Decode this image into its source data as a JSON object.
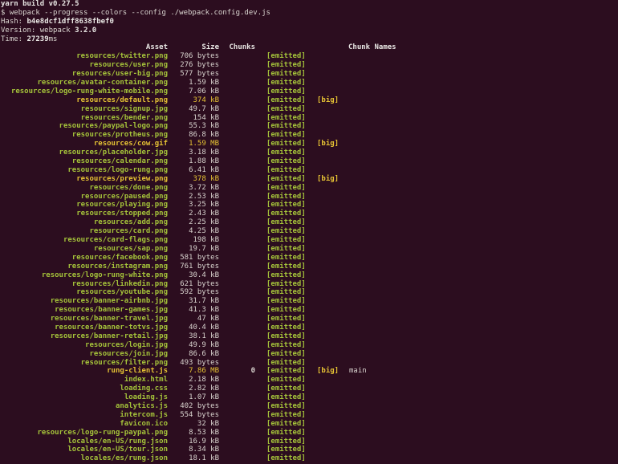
{
  "header_lines": [
    "yarn build v0.27.5",
    "$ webpack --progress --colors --config ./webpack.config.dev.js"
  ],
  "hash": {
    "label": "Hash: ",
    "value": "b4e8dcf1dff8638fbef0"
  },
  "version": {
    "label": "Version: webpack ",
    "value": "3.2.0"
  },
  "time": {
    "label": "Time: ",
    "value": "27239",
    "unit": "ms"
  },
  "table": {
    "columns": {
      "asset": "Asset",
      "size": "Size",
      "chunks": "Chunks",
      "names": "Chunk Names"
    },
    "rows": [
      {
        "asset": "resources/twitter.png",
        "size": "706 bytes",
        "status": "[emitted]"
      },
      {
        "asset": "resources/user.png",
        "size": "276 bytes",
        "status": "[emitted]"
      },
      {
        "asset": "resources/user-big.png",
        "size": "577 bytes",
        "status": "[emitted]"
      },
      {
        "asset": "resources/avatar-container.png",
        "size": "1.59 kB",
        "status": "[emitted]"
      },
      {
        "asset": "resources/logo-rung-white-mobile.png",
        "size": "7.06 kB",
        "status": "[emitted]"
      },
      {
        "asset": "resources/default.png",
        "size": "374 kB",
        "status": "[emitted]",
        "flag": "[big]",
        "big": true
      },
      {
        "asset": "resources/signup.jpg",
        "size": "49.7 kB",
        "status": "[emitted]"
      },
      {
        "asset": "resources/bender.png",
        "size": "154 kB",
        "status": "[emitted]"
      },
      {
        "asset": "resources/paypal-logo.png",
        "size": "55.3 kB",
        "status": "[emitted]"
      },
      {
        "asset": "resources/protheus.png",
        "size": "86.8 kB",
        "status": "[emitted]"
      },
      {
        "asset": "resources/cow.gif",
        "size": "1.59 MB",
        "status": "[emitted]",
        "flag": "[big]",
        "big": true
      },
      {
        "asset": "resources/placeholder.jpg",
        "size": "3.18 kB",
        "status": "[emitted]"
      },
      {
        "asset": "resources/calendar.png",
        "size": "1.88 kB",
        "status": "[emitted]"
      },
      {
        "asset": "resources/logo-rung.png",
        "size": "6.41 kB",
        "status": "[emitted]"
      },
      {
        "asset": "resources/preview.png",
        "size": "378 kB",
        "status": "[emitted]",
        "flag": "[big]",
        "big": true
      },
      {
        "asset": "resources/done.png",
        "size": "3.72 kB",
        "status": "[emitted]"
      },
      {
        "asset": "resources/paused.png",
        "size": "2.53 kB",
        "status": "[emitted]"
      },
      {
        "asset": "resources/playing.png",
        "size": "3.25 kB",
        "status": "[emitted]"
      },
      {
        "asset": "resources/stopped.png",
        "size": "2.43 kB",
        "status": "[emitted]"
      },
      {
        "asset": "resources/add.png",
        "size": "2.25 kB",
        "status": "[emitted]"
      },
      {
        "asset": "resources/card.png",
        "size": "4.25 kB",
        "status": "[emitted]"
      },
      {
        "asset": "resources/card-flags.png",
        "size": "198 kB",
        "status": "[emitted]"
      },
      {
        "asset": "resources/sap.png",
        "size": "19.7 kB",
        "status": "[emitted]"
      },
      {
        "asset": "resources/facebook.png",
        "size": "581 bytes",
        "status": "[emitted]"
      },
      {
        "asset": "resources/instagram.png",
        "size": "761 bytes",
        "status": "[emitted]"
      },
      {
        "asset": "resources/logo-rung-white.png",
        "size": "30.4 kB",
        "status": "[emitted]"
      },
      {
        "asset": "resources/linkedin.png",
        "size": "621 bytes",
        "status": "[emitted]"
      },
      {
        "asset": "resources/youtube.png",
        "size": "592 bytes",
        "status": "[emitted]"
      },
      {
        "asset": "resources/banner-airbnb.jpg",
        "size": "31.7 kB",
        "status": "[emitted]"
      },
      {
        "asset": "resources/banner-games.jpg",
        "size": "41.3 kB",
        "status": "[emitted]"
      },
      {
        "asset": "resources/banner-travel.jpg",
        "size": "47 kB",
        "status": "[emitted]"
      },
      {
        "asset": "resources/banner-totvs.jpg",
        "size": "40.4 kB",
        "status": "[emitted]"
      },
      {
        "asset": "resources/banner-retail.jpg",
        "size": "38.1 kB",
        "status": "[emitted]"
      },
      {
        "asset": "resources/login.jpg",
        "size": "49.9 kB",
        "status": "[emitted]"
      },
      {
        "asset": "resources/join.jpg",
        "size": "86.6 kB",
        "status": "[emitted]"
      },
      {
        "asset": "resources/filter.png",
        "size": "493 bytes",
        "status": "[emitted]"
      },
      {
        "asset": "rung-client.js",
        "size": "7.86 MB",
        "chunks": "0",
        "status": "[emitted]",
        "flag": "[big]",
        "names": "main",
        "big": true
      },
      {
        "asset": "index.html",
        "size": "2.18 kB",
        "status": "[emitted]"
      },
      {
        "asset": "loading.css",
        "size": "2.82 kB",
        "status": "[emitted]"
      },
      {
        "asset": "loading.js",
        "size": "1.07 kB",
        "status": "[emitted]"
      },
      {
        "asset": "analytics.js",
        "size": "402 bytes",
        "status": "[emitted]"
      },
      {
        "asset": "intercom.js",
        "size": "554 bytes",
        "status": "[emitted]"
      },
      {
        "asset": "favicon.ico",
        "size": "32 kB",
        "status": "[emitted]"
      },
      {
        "asset": "resources/logo-rung-paypal.png",
        "size": "8.53 kB",
        "status": "[emitted]"
      },
      {
        "asset": "locales/en-US/rung.json",
        "size": "16.9 kB",
        "status": "[emitted]"
      },
      {
        "asset": "locales/en-US/tour.json",
        "size": "8.34 kB",
        "status": "[emitted]"
      },
      {
        "asset": "locales/es/rung.json",
        "size": "18.1 kB",
        "status": "[emitted]"
      }
    ]
  }
}
